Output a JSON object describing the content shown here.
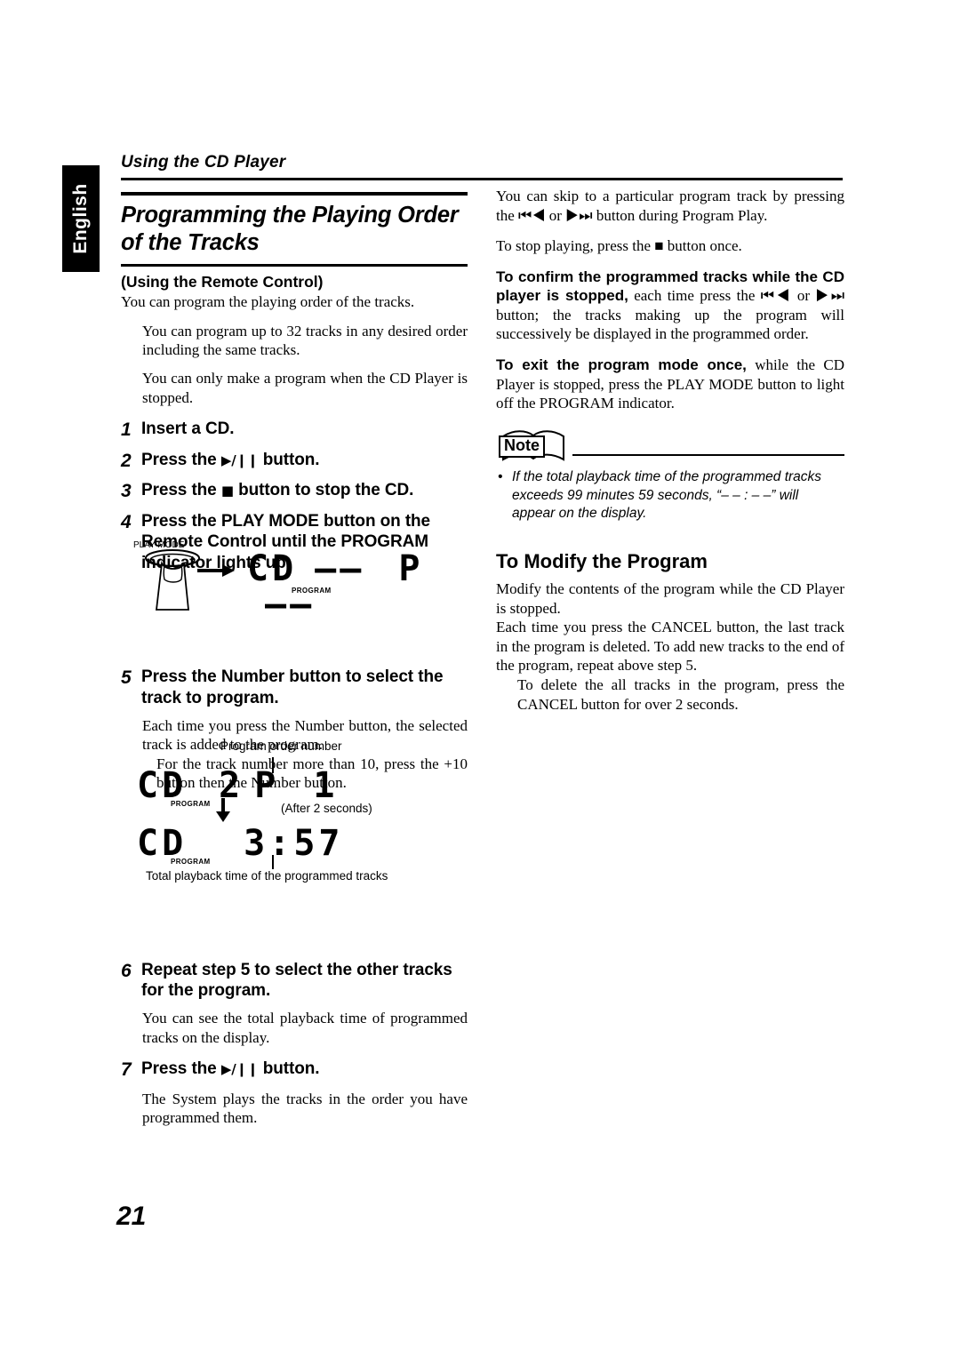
{
  "language_tab": "English",
  "running_head": "Using the CD Player",
  "page_number": "21",
  "left_column": {
    "section_title_line1": "Programming the Playing Order",
    "section_title_line2": "of the Tracks",
    "subtitle": "(Using the Remote Control)",
    "intro": "You can program the playing order of the tracks.",
    "note1": "You can program up to 32 tracks in any desired order including the same tracks.",
    "note2": "You can only make a program when the CD Player is stopped.",
    "steps": [
      {
        "num": "1",
        "text": "Insert a CD."
      },
      {
        "num": "2",
        "pre": "Press the ",
        "glyph": "▶/❙❙",
        "post": " button."
      },
      {
        "num": "3",
        "pre": "Press the ",
        "glyph": "■",
        "post": " button to stop the CD."
      },
      {
        "num": "4",
        "text": "Press the PLAY MODE button on the Remote Control until the  PROGRAM indicator lights up."
      },
      {
        "num": "5",
        "text": "Press the Number button to select the track to program."
      },
      {
        "num": "6",
        "text": "Repeat step 5 to select the other tracks for the program."
      },
      {
        "num": "7",
        "pre": "Press the ",
        "glyph": "▶/❙❙",
        "post": " button."
      }
    ],
    "step5_body1": "Each time you press the Number button, the selected track is added to the program.",
    "step5_body2": "For the track number more than 10, press the +10 button then the Number button.",
    "step6_body": "You can see the total playback time of programmed tracks on the display.",
    "step7_body": "The System plays the tracks in the order you have programmed them."
  },
  "figure_play_mode": {
    "button_label": "PLAY MODE",
    "arrow": "→",
    "display_cd": "CD",
    "display_dashes1": "––",
    "display_p": "P",
    "display_dashes2": "––",
    "program_label": "PROGRAM"
  },
  "figure_program": {
    "caption_top": "Program order number",
    "line1_cd": "CD",
    "line1_track": "2",
    "line1_p": "P",
    "line1_order": "1",
    "program_label": "PROGRAM",
    "after_label": "(After 2 seconds)",
    "arrow_down": "↓",
    "line2_cd": "CD",
    "line2_time": "3:57",
    "caption_bottom": "Total playback time of the programmed tracks"
  },
  "right_column": {
    "para1": "You can skip to a particular program track by pressing the ⏮◀ or ▶⏭ button during Program Play.",
    "para2": "To stop playing, press the ■ button once.",
    "confirm_lead": "To confirm the programmed tracks while the CD player is stopped,",
    "confirm_rest": " each time press the ⏮◀ or ▶⏭ button; the tracks making up the program will successively be displayed in the programmed order.",
    "exit_lead": "To exit the program mode once,",
    "exit_rest": " while the CD Player is stopped, press the PLAY MODE button to light off the  PROGRAM  indicator.",
    "note_label": "Note",
    "note_items": [
      "If the total playback time of the programmed tracks exceeds 99 minutes 59 seconds, “– – : – –” will appear on the display."
    ],
    "modify_title": "To Modify the Program",
    "modify_para1": "Modify the contents of the program while the CD Player is stopped.",
    "modify_para2": "Each time you press the CANCEL button, the last track in the program is deleted. To add new tracks to the end of the program, repeat above step 5.",
    "modify_para3": "To delete the all tracks in the program, press the CANCEL button for over 2 seconds."
  }
}
